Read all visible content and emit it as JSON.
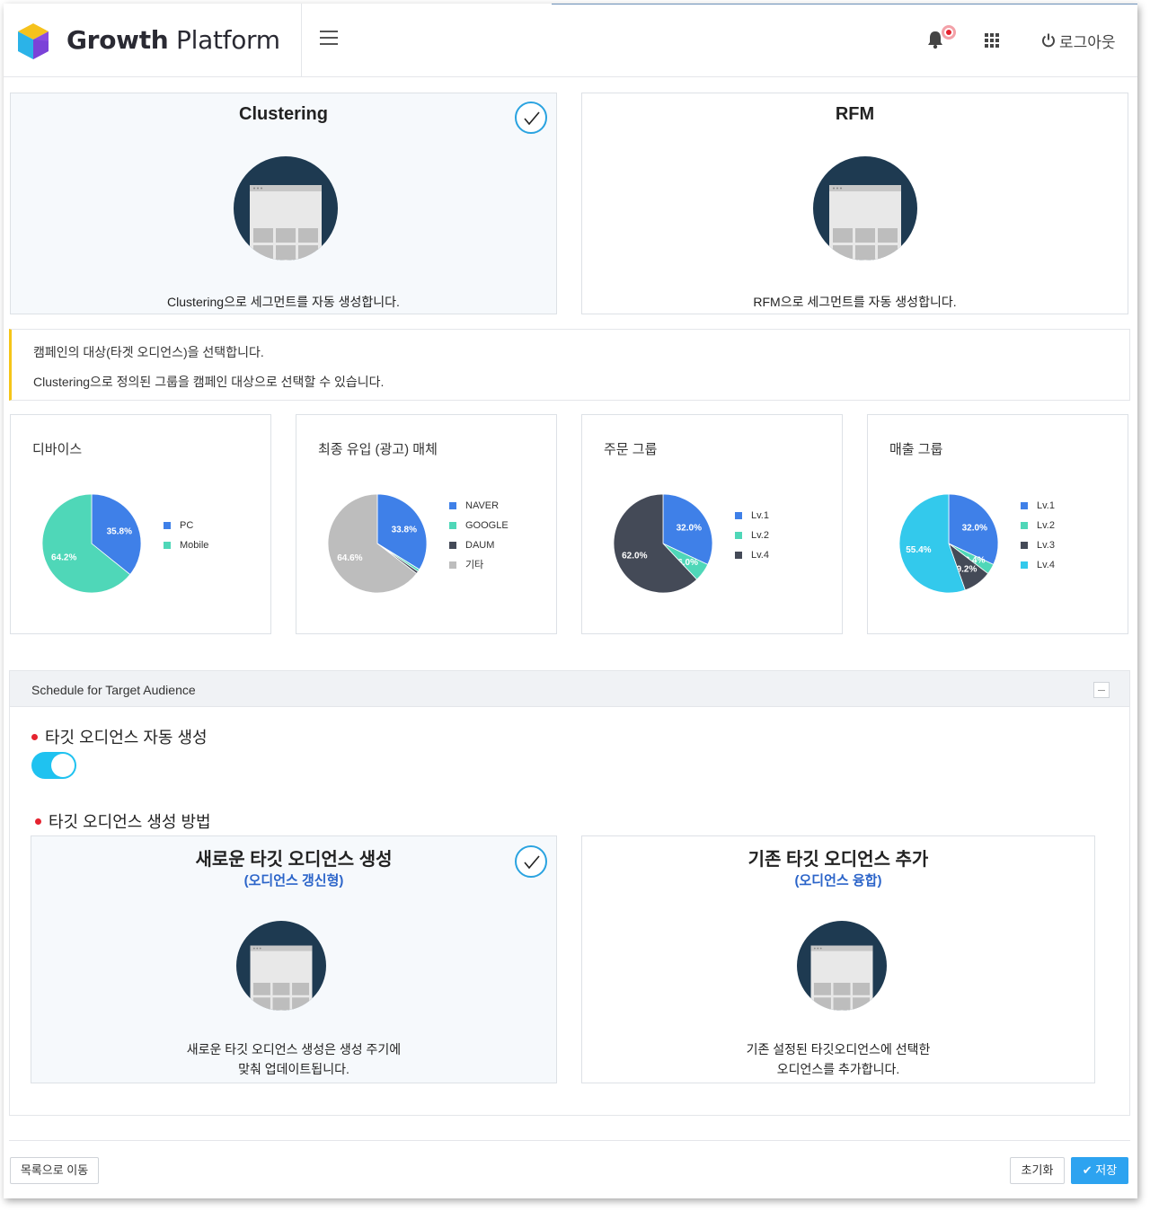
{
  "header": {
    "brand_bold": "Growth",
    "brand_thin": "Platform",
    "logout_label": "로그아웃"
  },
  "method_cards": [
    {
      "title": "Clustering",
      "desc": "Clustering으로 세그먼트를 자동 생성합니다.",
      "selected": true
    },
    {
      "title": "RFM",
      "desc": "RFM으로 세그먼트를 자동 생성합니다.",
      "selected": false
    }
  ],
  "notice": {
    "line1": "캠페인의 대상(타겟 오디언스)을 선택합니다.",
    "line2": "Clustering으로 정의된 그룹을 캠페인 대상으로 선택할 수 있습니다."
  },
  "charts": [
    {
      "title": "디바이스",
      "chart_data": {
        "type": "pie",
        "categories": [
          "PC",
          "Mobile"
        ],
        "values": [
          35.8,
          64.2
        ],
        "labels": [
          "35.8%",
          "64.2%"
        ],
        "colors": [
          "#3f80e8",
          "#4fd7b8"
        ]
      }
    },
    {
      "title": "최종 유입 (광고) 매체",
      "chart_data": {
        "type": "pie",
        "categories": [
          "NAVER",
          "GOOGLE",
          "DAUM",
          "기타"
        ],
        "values": [
          33.8,
          0.8,
          0.8,
          64.6
        ],
        "labels": [
          "33.8%",
          "",
          "",
          "64.6%"
        ],
        "colors": [
          "#3f80e8",
          "#4fd7b8",
          "#444a57",
          "#bdbdbd"
        ]
      }
    },
    {
      "title": "주문 그룹",
      "chart_data": {
        "type": "pie",
        "categories": [
          "Lv.1",
          "Lv.2",
          "Lv.4"
        ],
        "values": [
          32.0,
          6.0,
          62.0
        ],
        "labels": [
          "32.0%",
          "6.0%",
          "62.0%"
        ],
        "colors": [
          "#3f80e8",
          "#4fd7b8",
          "#444a57"
        ]
      }
    },
    {
      "title": "매출 그룹",
      "chart_data": {
        "type": "pie",
        "categories": [
          "Lv.1",
          "Lv.2",
          "Lv.3",
          "Lv.4"
        ],
        "values": [
          32.0,
          3.4,
          9.2,
          55.4
        ],
        "labels": [
          "32.0%",
          "3.4%",
          "9.2%",
          "55.4%"
        ],
        "colors": [
          "#3f80e8",
          "#4fd7b8",
          "#444a57",
          "#33c9ec"
        ]
      }
    }
  ],
  "schedule": {
    "title": "Schedule for Target Audience",
    "auto_create_label": "타깃 오디언스 자동 생성",
    "auto_create_on": true,
    "method_label": "타깃 오디언스 생성 방법",
    "options": [
      {
        "title": "새로운 타깃 오디언스 생성",
        "subtitle": "(오디언스 갱신형)",
        "desc1": "새로운 타깃 오디언스 생성은 생성 주기에",
        "desc2": "맞춰 업데이트됩니다.",
        "selected": true
      },
      {
        "title": "기존 타깃 오디언스 추가",
        "subtitle": "(오디언스 융합)",
        "desc1": "기존 설정된 타깃오디언스에 선택한",
        "desc2": "오디언스를 추가합니다.",
        "selected": false
      }
    ]
  },
  "footer": {
    "back_label": "목록으로 이동",
    "reset_label": "초기화",
    "save_label": "저장"
  }
}
